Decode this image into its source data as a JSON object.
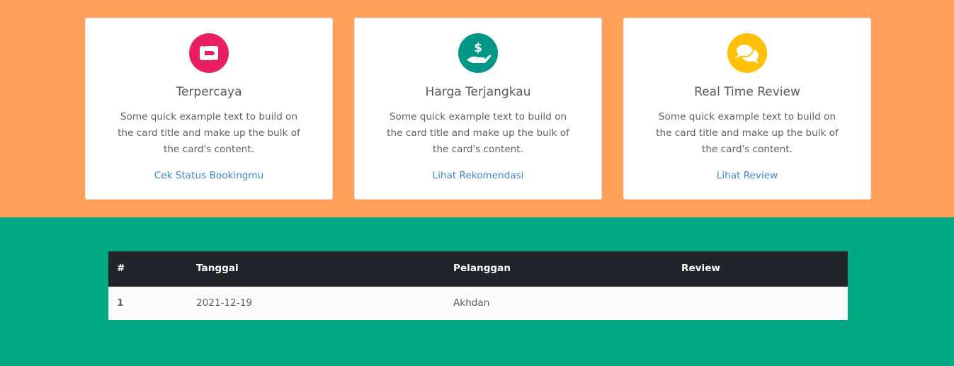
{
  "cards": [
    {
      "icon": "handshake-icon",
      "icon_color": "#e91e63",
      "title": "Terpercaya",
      "text": "Some quick example text to build on the card title and make up the bulk of the card's content.",
      "link": "Cek Status Bookingmu"
    },
    {
      "icon": "money-hand-icon",
      "icon_color": "#009688",
      "title": "Harga Terjangkau",
      "text": "Some quick example text to build on the card title and make up the bulk of the card's content.",
      "link": "Lihat Rekomendasi"
    },
    {
      "icon": "chat-bubbles-icon",
      "icon_color": "#ffc107",
      "title": "Real Time Review",
      "text": "Some quick example text to build on the card title and make up the bulk of the card's content.",
      "link": "Lihat Review"
    }
  ],
  "table": {
    "headers": [
      "#",
      "Tanggal",
      "Pelanggan",
      "Review"
    ],
    "rows": [
      [
        "1",
        "2021-12-19",
        "Akhdan",
        ""
      ]
    ]
  },
  "colors": {
    "top_band": "#ffa05a",
    "bottom_band": "#00a884",
    "link": "#3f86d6",
    "table_header": "#212529"
  }
}
